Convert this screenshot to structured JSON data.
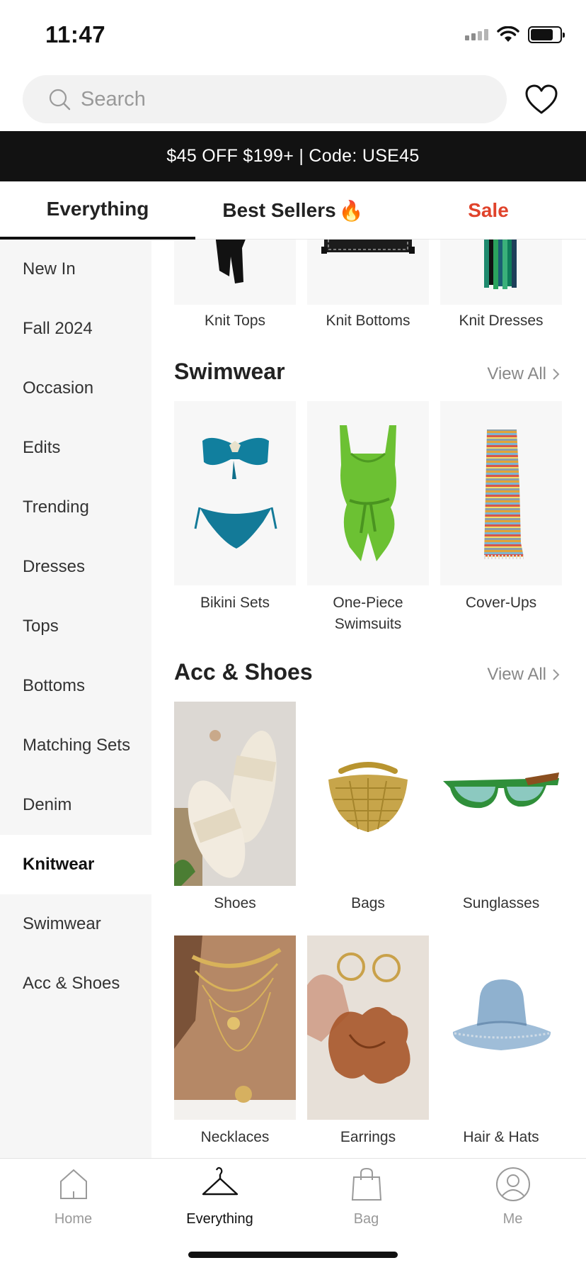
{
  "status_bar": {
    "time": "11:47"
  },
  "search": {
    "placeholder": "Search"
  },
  "promo": {
    "text": "$45 OFF $199+ | Code: USE45"
  },
  "top_tabs": [
    {
      "label": "Everything",
      "active": true
    },
    {
      "label": "Best Sellers",
      "icon": "fire-icon"
    },
    {
      "label": "Sale",
      "color": "#e0432b"
    }
  ],
  "sidebar": {
    "items": [
      {
        "label": "New In"
      },
      {
        "label": "Fall 2024"
      },
      {
        "label": "Occasion"
      },
      {
        "label": "Edits"
      },
      {
        "label": "Trending"
      },
      {
        "label": "Dresses"
      },
      {
        "label": "Tops"
      },
      {
        "label": "Bottoms"
      },
      {
        "label": "Matching Sets"
      },
      {
        "label": "Denim"
      },
      {
        "label": "Knitwear",
        "active": true
      },
      {
        "label": "Swimwear"
      },
      {
        "label": "Acc & Shoes"
      }
    ]
  },
  "knitwear": {
    "categories": [
      {
        "label": "Knit Tops"
      },
      {
        "label": "Knit Bottoms"
      },
      {
        "label": "Knit Dresses"
      }
    ]
  },
  "swimwear": {
    "title": "Swimwear",
    "view_all": "View All",
    "categories": [
      {
        "label": "Bikini Sets"
      },
      {
        "label": "One-Piece Swimsuits"
      },
      {
        "label": "Cover-Ups"
      }
    ]
  },
  "acc_shoes": {
    "title": "Acc & Shoes",
    "view_all": "View All",
    "categories": [
      {
        "label": "Shoes"
      },
      {
        "label": "Bags"
      },
      {
        "label": "Sunglasses"
      },
      {
        "label": "Necklaces"
      },
      {
        "label": "Earrings"
      },
      {
        "label": "Hair & Hats"
      }
    ]
  },
  "bottom_nav": [
    {
      "label": "Home",
      "icon": "home-icon"
    },
    {
      "label": "Everything",
      "icon": "hanger-icon",
      "active": true
    },
    {
      "label": "Bag",
      "icon": "shopping-bag-icon"
    },
    {
      "label": "Me",
      "icon": "profile-icon"
    }
  ],
  "colors": {
    "accent_sale": "#e0432b",
    "promo_bg": "#121212",
    "sidebar_bg": "#f6f6f6"
  }
}
